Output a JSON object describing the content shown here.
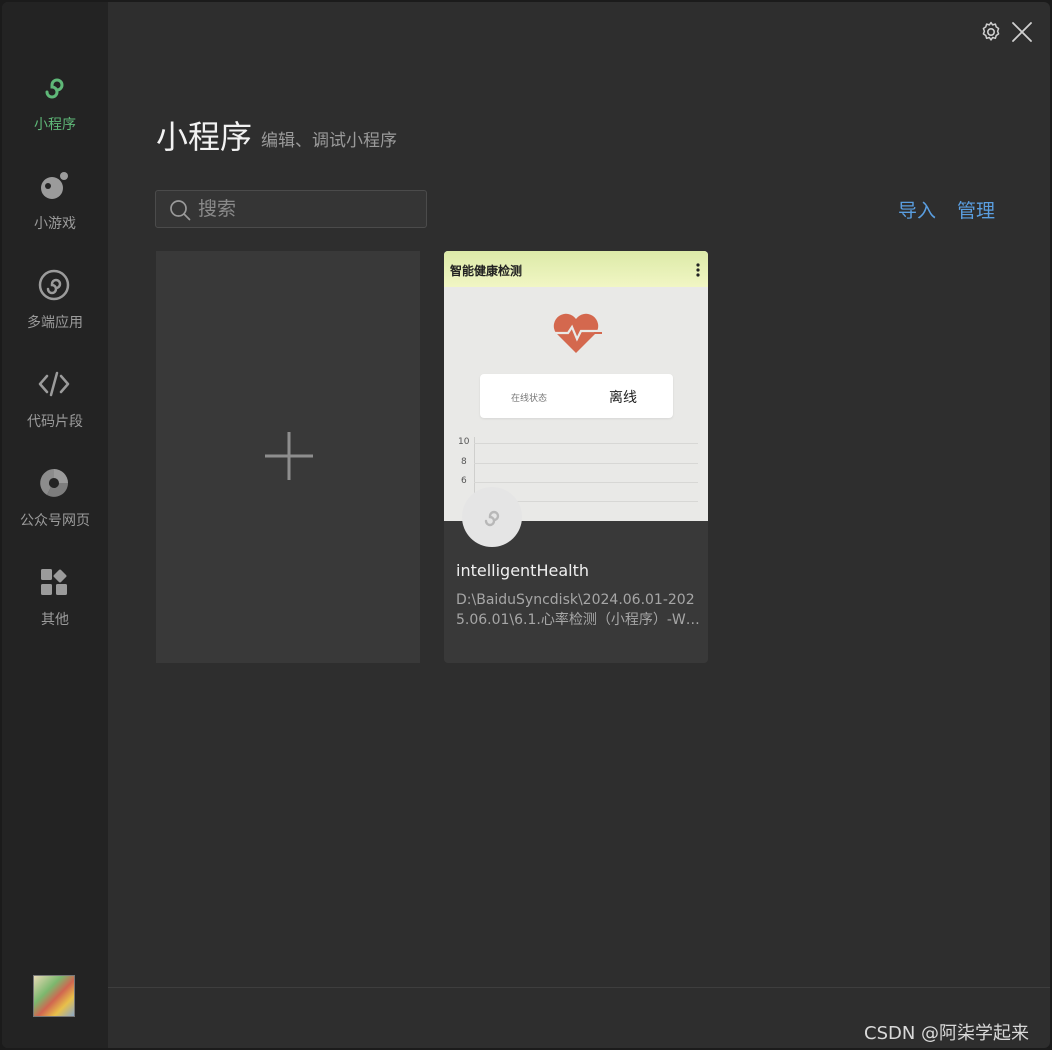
{
  "sidebar": {
    "items": [
      {
        "label": "小程序",
        "icon": "mini-program-icon",
        "active": true
      },
      {
        "label": "小游戏",
        "icon": "mini-game-icon",
        "active": false
      },
      {
        "label": "多端应用",
        "icon": "multi-platform-icon",
        "active": false
      },
      {
        "label": "代码片段",
        "icon": "code-icon",
        "active": false
      },
      {
        "label": "公众号网页",
        "icon": "official-account-icon",
        "active": false
      },
      {
        "label": "其他",
        "icon": "other-apps-icon",
        "active": false
      }
    ],
    "avatar": "user-avatar"
  },
  "header": {
    "title": "小程序",
    "subtitle": "编辑、调试小程序"
  },
  "toolbar": {
    "search_placeholder": "搜索",
    "import_label": "导入",
    "manage_label": "管理"
  },
  "projects": [
    {
      "name": "intelligentHealth",
      "path": "D:\\BaiduSyncdisk\\2024.06.01-2025.06.01\\6.1.心率检测（小程序）-Wi...",
      "preview": {
        "title": "智能健康检测",
        "status_label": "在线状态",
        "status_value": "离线",
        "ticks": [
          "10",
          "8",
          "6"
        ]
      }
    }
  ],
  "watermark": "CSDN @阿柒学起来",
  "colors": {
    "accent_green": "#5fb878",
    "link_blue": "#5a9ee0",
    "heart": "#d4684e"
  }
}
